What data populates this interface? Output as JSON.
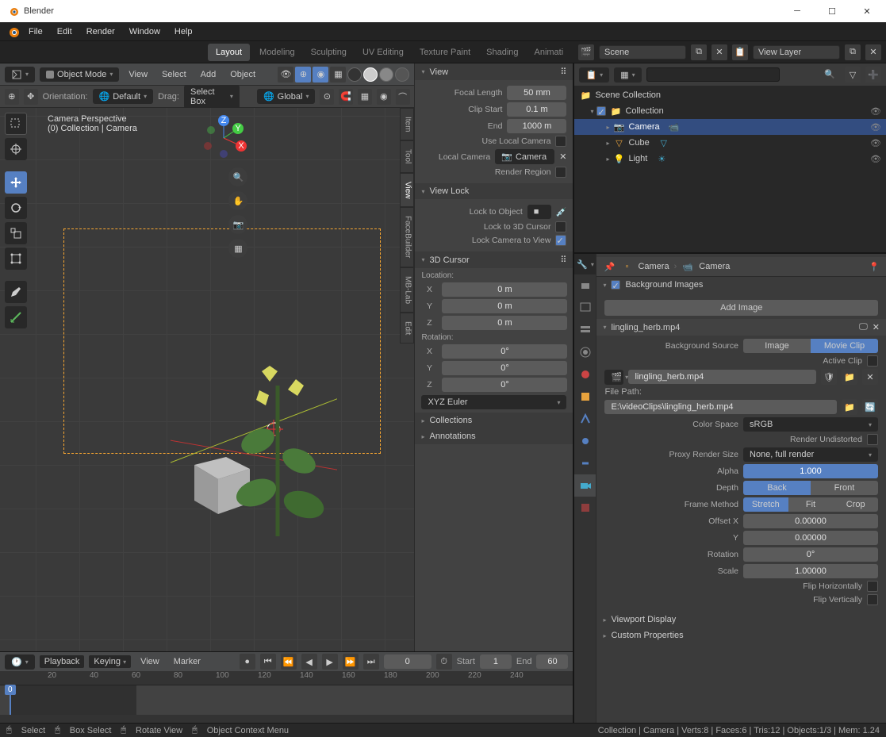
{
  "window": {
    "title": "Blender"
  },
  "menu": {
    "file": "File",
    "edit": "Edit",
    "render": "Render",
    "window": "Window",
    "help": "Help"
  },
  "workspaces": {
    "layout": "Layout",
    "modeling": "Modeling",
    "sculpting": "Sculpting",
    "uv": "UV Editing",
    "texture": "Texture Paint",
    "shading": "Shading",
    "animation": "Animati"
  },
  "header": {
    "scene": "Scene",
    "viewlayer": "View Layer"
  },
  "vp_header": {
    "mode": "Object Mode",
    "view": "View",
    "select": "Select",
    "add": "Add",
    "object": "Object",
    "orientation_lbl": "Orientation:",
    "orientation": "Default",
    "drag_lbl": "Drag:",
    "drag": "Select Box",
    "global": "Global"
  },
  "vp_info": {
    "persp": "Camera Perspective",
    "coll": "(0) Collection | Camera"
  },
  "npanel": {
    "tabs": {
      "item": "Item",
      "tool": "Tool",
      "view": "View",
      "facebuilder": "FaceBuilder",
      "mblab": "MB-Lab",
      "edit": "Edit"
    },
    "view_hdr": "View",
    "view": {
      "focal_lbl": "Focal Length",
      "focal": "50 mm",
      "clipstart_lbl": "Clip Start",
      "clipstart": "0.1 m",
      "end_lbl": "End",
      "end": "1000 m",
      "uselocal": "Use Local Camera",
      "localcam_lbl": "Local Camera",
      "localcam": "Camera",
      "renderregion": "Render Region"
    },
    "viewlock_hdr": "View Lock",
    "viewlock": {
      "lockobj": "Lock to Object",
      "lock3d": "Lock to 3D Cursor",
      "lockcam": "Lock Camera to View"
    },
    "cursor_hdr": "3D Cursor",
    "cursor": {
      "loc_lbl": "Location:",
      "x_lbl": "X",
      "x": "0 m",
      "y_lbl": "Y",
      "y": "0 m",
      "z_lbl": "Z",
      "z": "0 m",
      "rot_lbl": "Rotation:",
      "rx_lbl": "X",
      "rx": "0°",
      "ry_lbl": "Y",
      "ry": "0°",
      "rz_lbl": "Z",
      "rz": "0°",
      "euler": "XYZ Euler"
    },
    "collections_hdr": "Collections",
    "annotations_hdr": "Annotations"
  },
  "timeline": {
    "playback": "Playback",
    "keying": "Keying",
    "view": "View",
    "marker": "Marker",
    "start_lbl": "Start",
    "start": "1",
    "end_lbl": "End",
    "end": "60",
    "current": "0",
    "ticks": [
      "20",
      "40",
      "60",
      "80",
      "100",
      "120",
      "140",
      "160",
      "180",
      "200",
      "220",
      "240"
    ]
  },
  "outliner": {
    "search_ph": "",
    "scene_coll": "Scene Collection",
    "collection": "Collection",
    "camera": "Camera",
    "cube": "Cube",
    "light": "Light"
  },
  "props": {
    "breadcrumb1": "Camera",
    "breadcrumb2": "Camera",
    "bgimg_hdr": "Background Images",
    "addimg": "Add Image",
    "clip_name": "lingling_herb.mp4",
    "bgsrc_lbl": "Background Source",
    "bgsrc_image": "Image",
    "bgsrc_movie": "Movie Clip",
    "activeclip": "Active Clip",
    "clipfile": "lingling_herb.mp4",
    "filepath_lbl": "File Path:",
    "filepath": "E:\\videoClips\\lingling_herb.mp4",
    "colorspace_lbl": "Color Space",
    "colorspace": "sRGB",
    "render_undist": "Render Undistorted",
    "proxy_lbl": "Proxy Render Size",
    "proxy": "None, full render",
    "alpha_lbl": "Alpha",
    "alpha": "1.000",
    "depth_lbl": "Depth",
    "depth_back": "Back",
    "depth_front": "Front",
    "framemethod_lbl": "Frame Method",
    "fm_stretch": "Stretch",
    "fm_fit": "Fit",
    "fm_crop": "Crop",
    "offsetx_lbl": "Offset X",
    "offsetx": "0.00000",
    "offsety_lbl": "Y",
    "offsety": "0.00000",
    "rotation_lbl": "Rotation",
    "rotation": "0°",
    "scale_lbl": "Scale",
    "scale": "1.00000",
    "fliph": "Flip Horizontally",
    "flipv": "Flip Vertically",
    "viewport_display": "Viewport Display",
    "custom_props": "Custom Properties"
  },
  "status": {
    "select": "Select",
    "boxselect": "Box Select",
    "rotate": "Rotate View",
    "ctxmenu": "Object Context Menu",
    "right": "Collection | Camera | Verts:8 | Faces:6 | Tris:12 | Objects:1/3 | Mem: 1.24"
  }
}
